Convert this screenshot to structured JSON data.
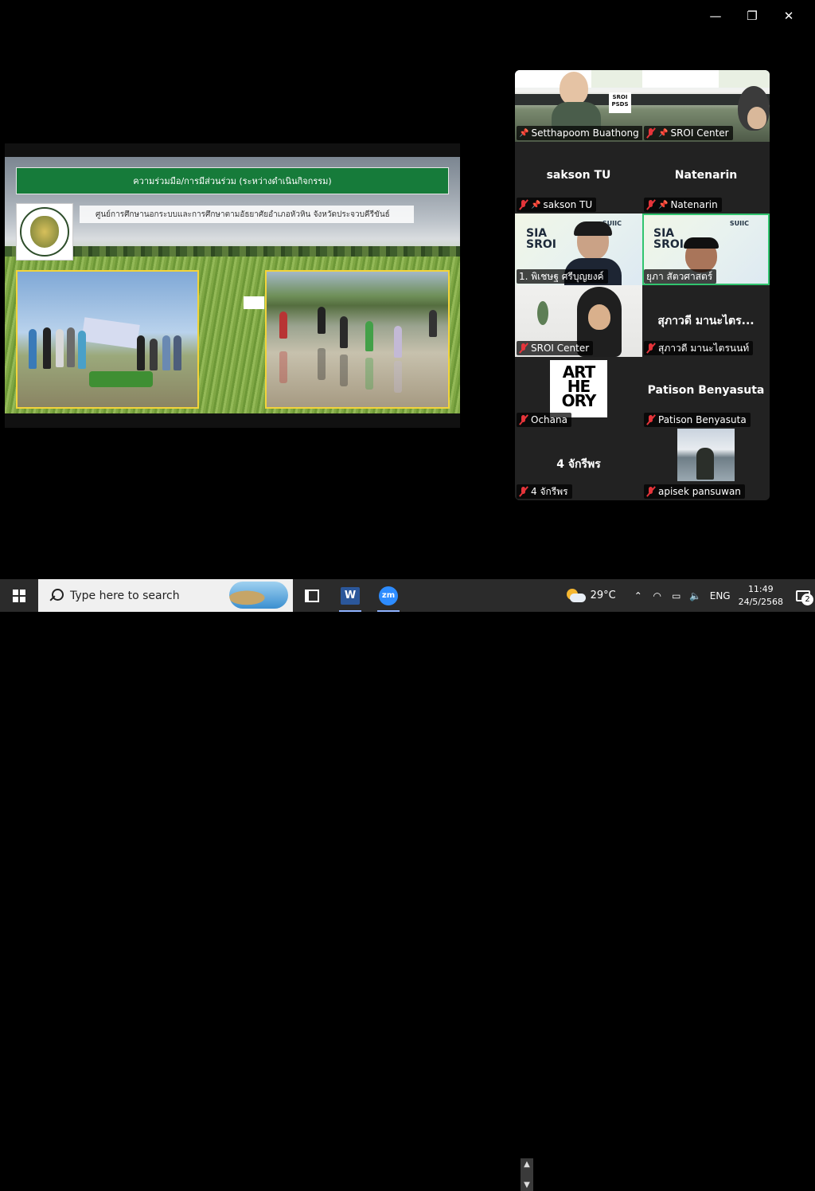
{
  "window_controls": {
    "minimize": "—",
    "restore": "❐",
    "close": "✕"
  },
  "slide": {
    "title": "ความร่วมมือ/การมีส่วนร่วม (ระหว่างดำเนินกิจกรรม)",
    "subtitle": "ศูนย์การศึกษานอกระบบและการศึกษาตามอัธยาศัยอำเภอหัวหิน จังหวัดประจวบคีรีขันธ์"
  },
  "participants": [
    {
      "name": "Setthapoom Buathong",
      "muted": true,
      "pinned": true,
      "video": "slide-room"
    },
    {
      "name": "SROI Center",
      "muted": true,
      "pinned": true,
      "video": "slide-room-2"
    },
    {
      "name": "sakson TU",
      "display": "sakson TU",
      "muted": true,
      "pinned": true,
      "video": "off"
    },
    {
      "name": "Natenarin",
      "display": "Natenarin",
      "muted": true,
      "pinned": true,
      "video": "off"
    },
    {
      "name": "1. พิเชษฐ ศรีบุญยงค์",
      "muted": false,
      "video": "sia",
      "sia_text": "SIA\nSROI",
      "brand": "SUIIC"
    },
    {
      "name": "ยุภา สัตวศาสตร์",
      "muted": false,
      "video": "sia",
      "active": true,
      "sia_text": "SIA\nSROI",
      "brand": "SUIIC"
    },
    {
      "name": "SROI Center",
      "muted": true,
      "video": "room"
    },
    {
      "name": "สุภาวดี มานะไตรนนท์",
      "display": "สุภาวดี มานะไตร...",
      "muted": true,
      "video": "off"
    },
    {
      "name": "Ochana",
      "muted": true,
      "video": "logo",
      "logo_text": "ART HE ORY"
    },
    {
      "name": "Patison Benyasuta",
      "display": "Patison Benyasuta",
      "muted": true,
      "video": "off"
    },
    {
      "name": "4 จักรีพร",
      "display": "4 จักรีพร",
      "muted": true,
      "video": "off"
    },
    {
      "name": "apisek pansuwan",
      "muted": true,
      "video": "photo"
    }
  ],
  "taskbar": {
    "search_placeholder": "Type here to search",
    "apps": [
      "task-view",
      "word",
      "zoom"
    ],
    "word_label": "W",
    "zoom_label": "zm",
    "weather": "29°C",
    "language": "ENG",
    "time": "11:49",
    "date": "24/5/2568",
    "notification_count": "2"
  },
  "colors": {
    "slide_title_bg": "#167b3a",
    "active_speaker": "#31c46f",
    "muted": "#e5343a"
  }
}
